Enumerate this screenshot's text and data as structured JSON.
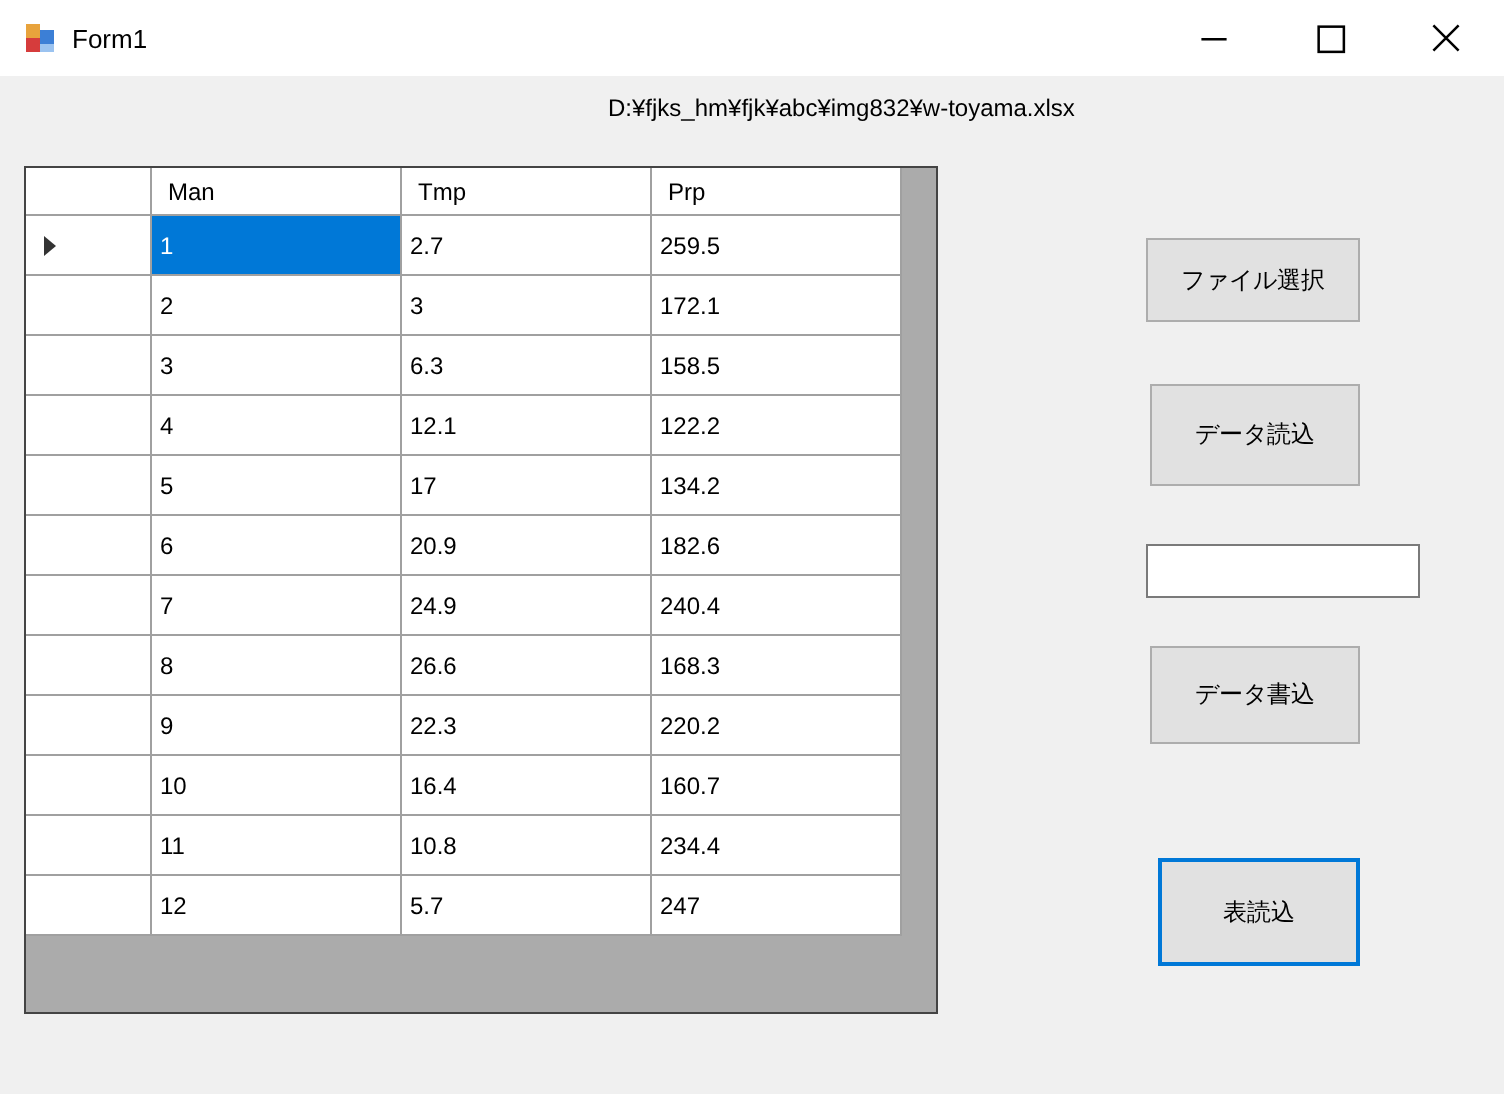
{
  "window": {
    "title": "Form1"
  },
  "file_path": "D:¥fjks_hm¥fjk¥abc¥img832¥w-toyama.xlsx",
  "grid": {
    "columns": [
      "Man",
      "Tmp",
      "Prp"
    ],
    "rows": [
      {
        "current": true,
        "cells": [
          {
            "text": "1",
            "selected": true
          },
          {
            "text": "2.7",
            "selected": false
          },
          {
            "text": "259.5",
            "selected": false
          }
        ]
      },
      {
        "current": false,
        "cells": [
          {
            "text": "2",
            "selected": false
          },
          {
            "text": "3",
            "selected": false
          },
          {
            "text": "172.1",
            "selected": false
          }
        ]
      },
      {
        "current": false,
        "cells": [
          {
            "text": "3",
            "selected": false
          },
          {
            "text": "6.3",
            "selected": false
          },
          {
            "text": "158.5",
            "selected": false
          }
        ]
      },
      {
        "current": false,
        "cells": [
          {
            "text": "4",
            "selected": false
          },
          {
            "text": "12.1",
            "selected": false
          },
          {
            "text": "122.2",
            "selected": false
          }
        ]
      },
      {
        "current": false,
        "cells": [
          {
            "text": "5",
            "selected": false
          },
          {
            "text": "17",
            "selected": false
          },
          {
            "text": "134.2",
            "selected": false
          }
        ]
      },
      {
        "current": false,
        "cells": [
          {
            "text": "6",
            "selected": false
          },
          {
            "text": "20.9",
            "selected": false
          },
          {
            "text": "182.6",
            "selected": false
          }
        ]
      },
      {
        "current": false,
        "cells": [
          {
            "text": "7",
            "selected": false
          },
          {
            "text": "24.9",
            "selected": false
          },
          {
            "text": "240.4",
            "selected": false
          }
        ]
      },
      {
        "current": false,
        "cells": [
          {
            "text": "8",
            "selected": false
          },
          {
            "text": "26.6",
            "selected": false
          },
          {
            "text": "168.3",
            "selected": false
          }
        ]
      },
      {
        "current": false,
        "cells": [
          {
            "text": "9",
            "selected": false
          },
          {
            "text": "22.3",
            "selected": false
          },
          {
            "text": "220.2",
            "selected": false
          }
        ]
      },
      {
        "current": false,
        "cells": [
          {
            "text": "10",
            "selected": false
          },
          {
            "text": "16.4",
            "selected": false
          },
          {
            "text": "160.7",
            "selected": false
          }
        ]
      },
      {
        "current": false,
        "cells": [
          {
            "text": "11",
            "selected": false
          },
          {
            "text": "10.8",
            "selected": false
          },
          {
            "text": "234.4",
            "selected": false
          }
        ]
      },
      {
        "current": false,
        "cells": [
          {
            "text": "12",
            "selected": false
          },
          {
            "text": "5.7",
            "selected": false
          },
          {
            "text": "247",
            "selected": false
          }
        ]
      }
    ]
  },
  "controls": [
    {
      "kind": "button",
      "label": "ファイル選択",
      "focused": false
    },
    {
      "kind": "button",
      "label": "データ読込",
      "focused": false
    },
    {
      "kind": "textbox"
    },
    {
      "kind": "button",
      "label": "データ書込",
      "focused": false
    },
    {
      "kind": "button",
      "label": "表読込",
      "focused": true
    }
  ]
}
